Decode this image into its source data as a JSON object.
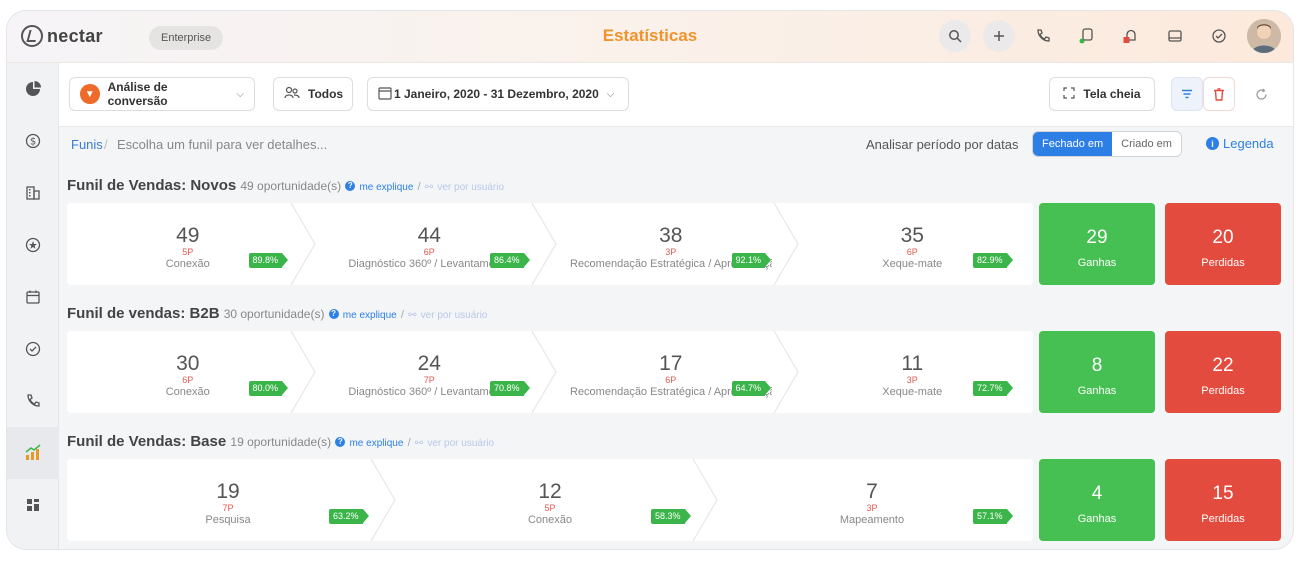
{
  "app": {
    "logo_text": "nectar",
    "plan": "Enterprise",
    "page_title": "Estatísticas"
  },
  "topbar": {
    "icons": [
      "search-icon",
      "plus-icon",
      "phone-icon",
      "chat-icon",
      "bell-icon",
      "inbox-icon",
      "check-circle-icon",
      "user-avatar"
    ]
  },
  "sidebar": {
    "items": [
      "pie-chart-icon",
      "dollar-icon",
      "building-icon",
      "star-icon",
      "calendar-icon",
      "check-icon",
      "phone-icon",
      "stats-icon",
      "grid-icon"
    ],
    "active": "stats-icon"
  },
  "toolbar": {
    "analysis_label": "Análise de conversão",
    "users_label": "Todos",
    "date_range": "1 Janeiro, 2020 - 31 Dezembro, 2020",
    "fullscreen_label": "Tela cheia"
  },
  "breadcrumb": {
    "root": "Funis",
    "separator": "/",
    "hint": "Escolha um funil para ver detalhes...",
    "period_label": "Analisar período por datas",
    "segment_on": "Fechado em",
    "segment_off": "Criado em",
    "legend_label": "Legenda",
    "legend_info": "i"
  },
  "colors": {
    "accent": "#f0932b",
    "primary": "#2d7fe5",
    "won": "#46c053",
    "lost": "#e24b3e",
    "rate": "#3bb54a"
  },
  "funnels": [
    {
      "title": "Funil de Vendas: Novos",
      "count": "49 oportunidade(s)",
      "explain": "me explique",
      "per_user": "ver por usuário",
      "stages": [
        {
          "num": "49",
          "pts": "5P",
          "name": "Conexão",
          "rate": "89.8%"
        },
        {
          "num": "44",
          "pts": "6P",
          "name": "Diagnóstico 360º / Levantamento",
          "rate": "86.4%"
        },
        {
          "num": "38",
          "pts": "3P",
          "name": "Recomendação Estratégica / Apresentação",
          "rate": "92.1%"
        },
        {
          "num": "35",
          "pts": "6P",
          "name": "Xeque-mate",
          "rate": "82.9%"
        }
      ],
      "won": "29",
      "won_label": "Ganhas",
      "lost": "20",
      "lost_label": "Perdidas"
    },
    {
      "title": "Funil de vendas: B2B",
      "count": "30 oportunidade(s)",
      "explain": "me explique",
      "per_user": "ver por usuário",
      "stages": [
        {
          "num": "30",
          "pts": "6P",
          "name": "Conexão",
          "rate": "80.0%"
        },
        {
          "num": "24",
          "pts": "7P",
          "name": "Diagnóstico 360º / Levantamento",
          "rate": "70.8%"
        },
        {
          "num": "17",
          "pts": "6P",
          "name": "Recomendação Estratégica / Apresentação",
          "rate": "64.7%"
        },
        {
          "num": "11",
          "pts": "3P",
          "name": "Xeque-mate",
          "rate": "72.7%"
        }
      ],
      "won": "8",
      "won_label": "Ganhas",
      "lost": "22",
      "lost_label": "Perdidas"
    },
    {
      "title": "Funil de Vendas: Base",
      "count": "19 oportunidade(s)",
      "explain": "me explique",
      "per_user": "ver por usuário",
      "stages": [
        {
          "num": "19",
          "pts": "7P",
          "name": "Pesquisa",
          "rate": "63.2%"
        },
        {
          "num": "12",
          "pts": "5P",
          "name": "Conexão",
          "rate": "58.3%"
        },
        {
          "num": "7",
          "pts": "3P",
          "name": "Mapeamento",
          "rate": "57.1%"
        }
      ],
      "won": "4",
      "won_label": "Ganhas",
      "lost": "15",
      "lost_label": "Perdidas"
    }
  ]
}
